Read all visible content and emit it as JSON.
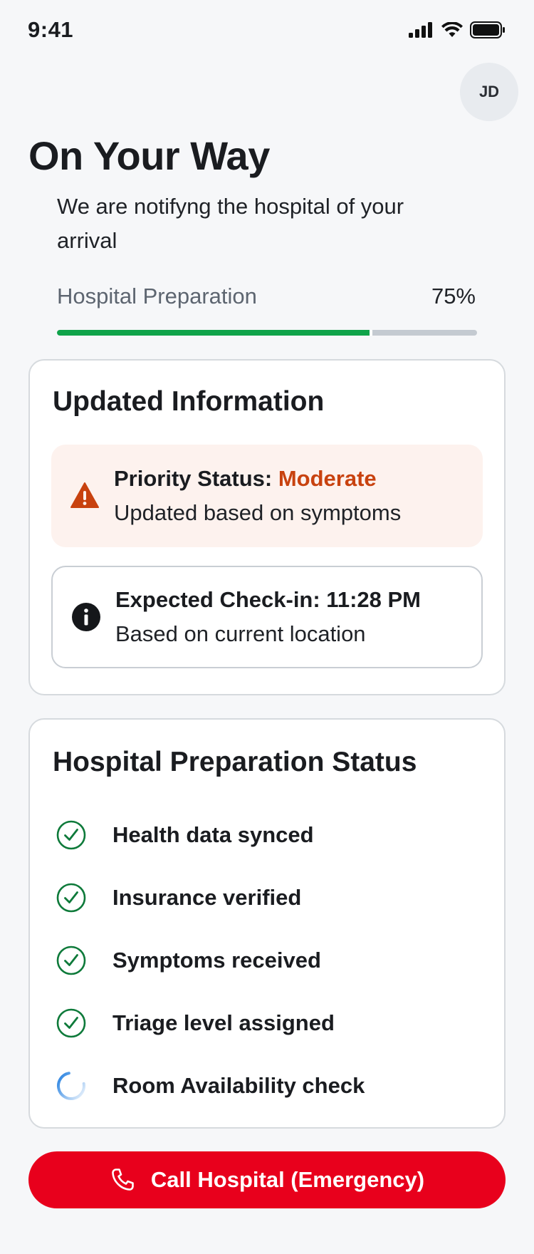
{
  "status_bar": {
    "time": "9:41"
  },
  "header": {
    "avatar_initials": "JD",
    "title": "On Your Way",
    "subtitle": "We are notifyng the hospital of your arrival"
  },
  "progress": {
    "label": "Hospital Preparation",
    "value_text": "75%",
    "fraction": 0.75,
    "fill_color": "#0fa34a"
  },
  "updated_info": {
    "title": "Updated Information",
    "priority": {
      "label": "Priority Status: ",
      "value": "Moderate",
      "note": "Updated based on symptoms",
      "accent_color": "#c8420f",
      "icon": "warning-icon"
    },
    "checkin": {
      "label": "Expected Check-in: 11:28 PM",
      "note": "Based on current location",
      "icon": "info-icon"
    }
  },
  "prep_status": {
    "title": "Hospital Preparation Status",
    "items": [
      {
        "label": "Health data synced",
        "state": "done",
        "icon": "check-circle-icon"
      },
      {
        "label": "Insurance verified",
        "state": "done",
        "icon": "check-circle-icon"
      },
      {
        "label": "Symptoms received",
        "state": "done",
        "icon": "check-circle-icon"
      },
      {
        "label": "Triage level assigned",
        "state": "done",
        "icon": "check-circle-icon"
      },
      {
        "label": "Room Availability check",
        "state": "loading",
        "icon": "spinner-icon"
      }
    ]
  },
  "call_button": {
    "label": "Call Hospital (Emergency)",
    "icon": "phone-icon",
    "color": "#e8001c"
  }
}
